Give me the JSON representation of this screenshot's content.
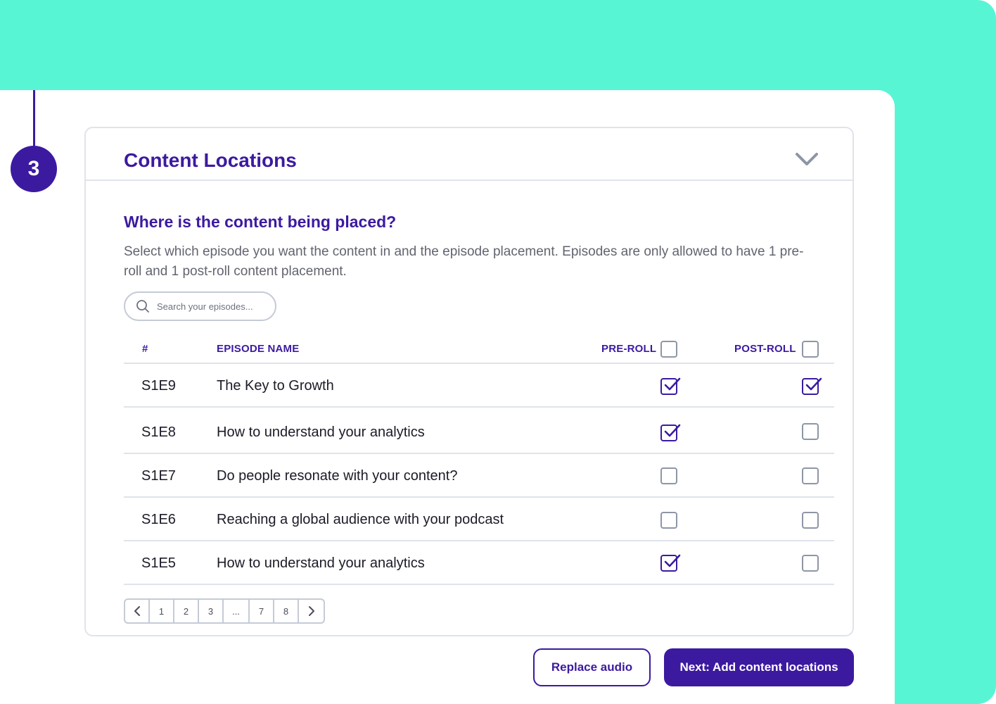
{
  "step": {
    "number": "3"
  },
  "section": {
    "title": "Content Locations",
    "question": "Where is the content being placed?",
    "description": "Select which episode you want the content in and the episode placement. Episodes are only allowed to have 1 pre-roll and 1 post-roll content placement."
  },
  "search": {
    "placeholder": "Search your episodes..."
  },
  "table": {
    "headers": {
      "number": "#",
      "name": "EPISODE NAME",
      "preroll": "PRE-ROLL",
      "postroll": "POST-ROLL"
    },
    "header_checkboxes": {
      "preroll": false,
      "postroll": false
    },
    "rows": [
      {
        "id": "S1E9",
        "name": "The Key to Growth",
        "preroll": true,
        "postroll": true
      },
      {
        "id": "S1E8",
        "name": "How to understand your analytics",
        "preroll": true,
        "postroll": false
      },
      {
        "id": "S1E7",
        "name": "Do people resonate with your content?",
        "preroll": false,
        "postroll": false
      },
      {
        "id": "S1E6",
        "name": "Reaching a global audience with your podcast",
        "preroll": false,
        "postroll": false
      },
      {
        "id": "S1E5",
        "name": "How to understand your analytics",
        "preroll": true,
        "postroll": false
      }
    ]
  },
  "pagination": {
    "pages": [
      "1",
      "2",
      "3",
      "...",
      "7",
      "8"
    ]
  },
  "actions": {
    "replace_label": "Replace audio",
    "next_label": "Next: Add content locations"
  },
  "colors": {
    "accent": "#3c1aa0",
    "background": "#58f5d5",
    "border": "#dfe4ec"
  }
}
